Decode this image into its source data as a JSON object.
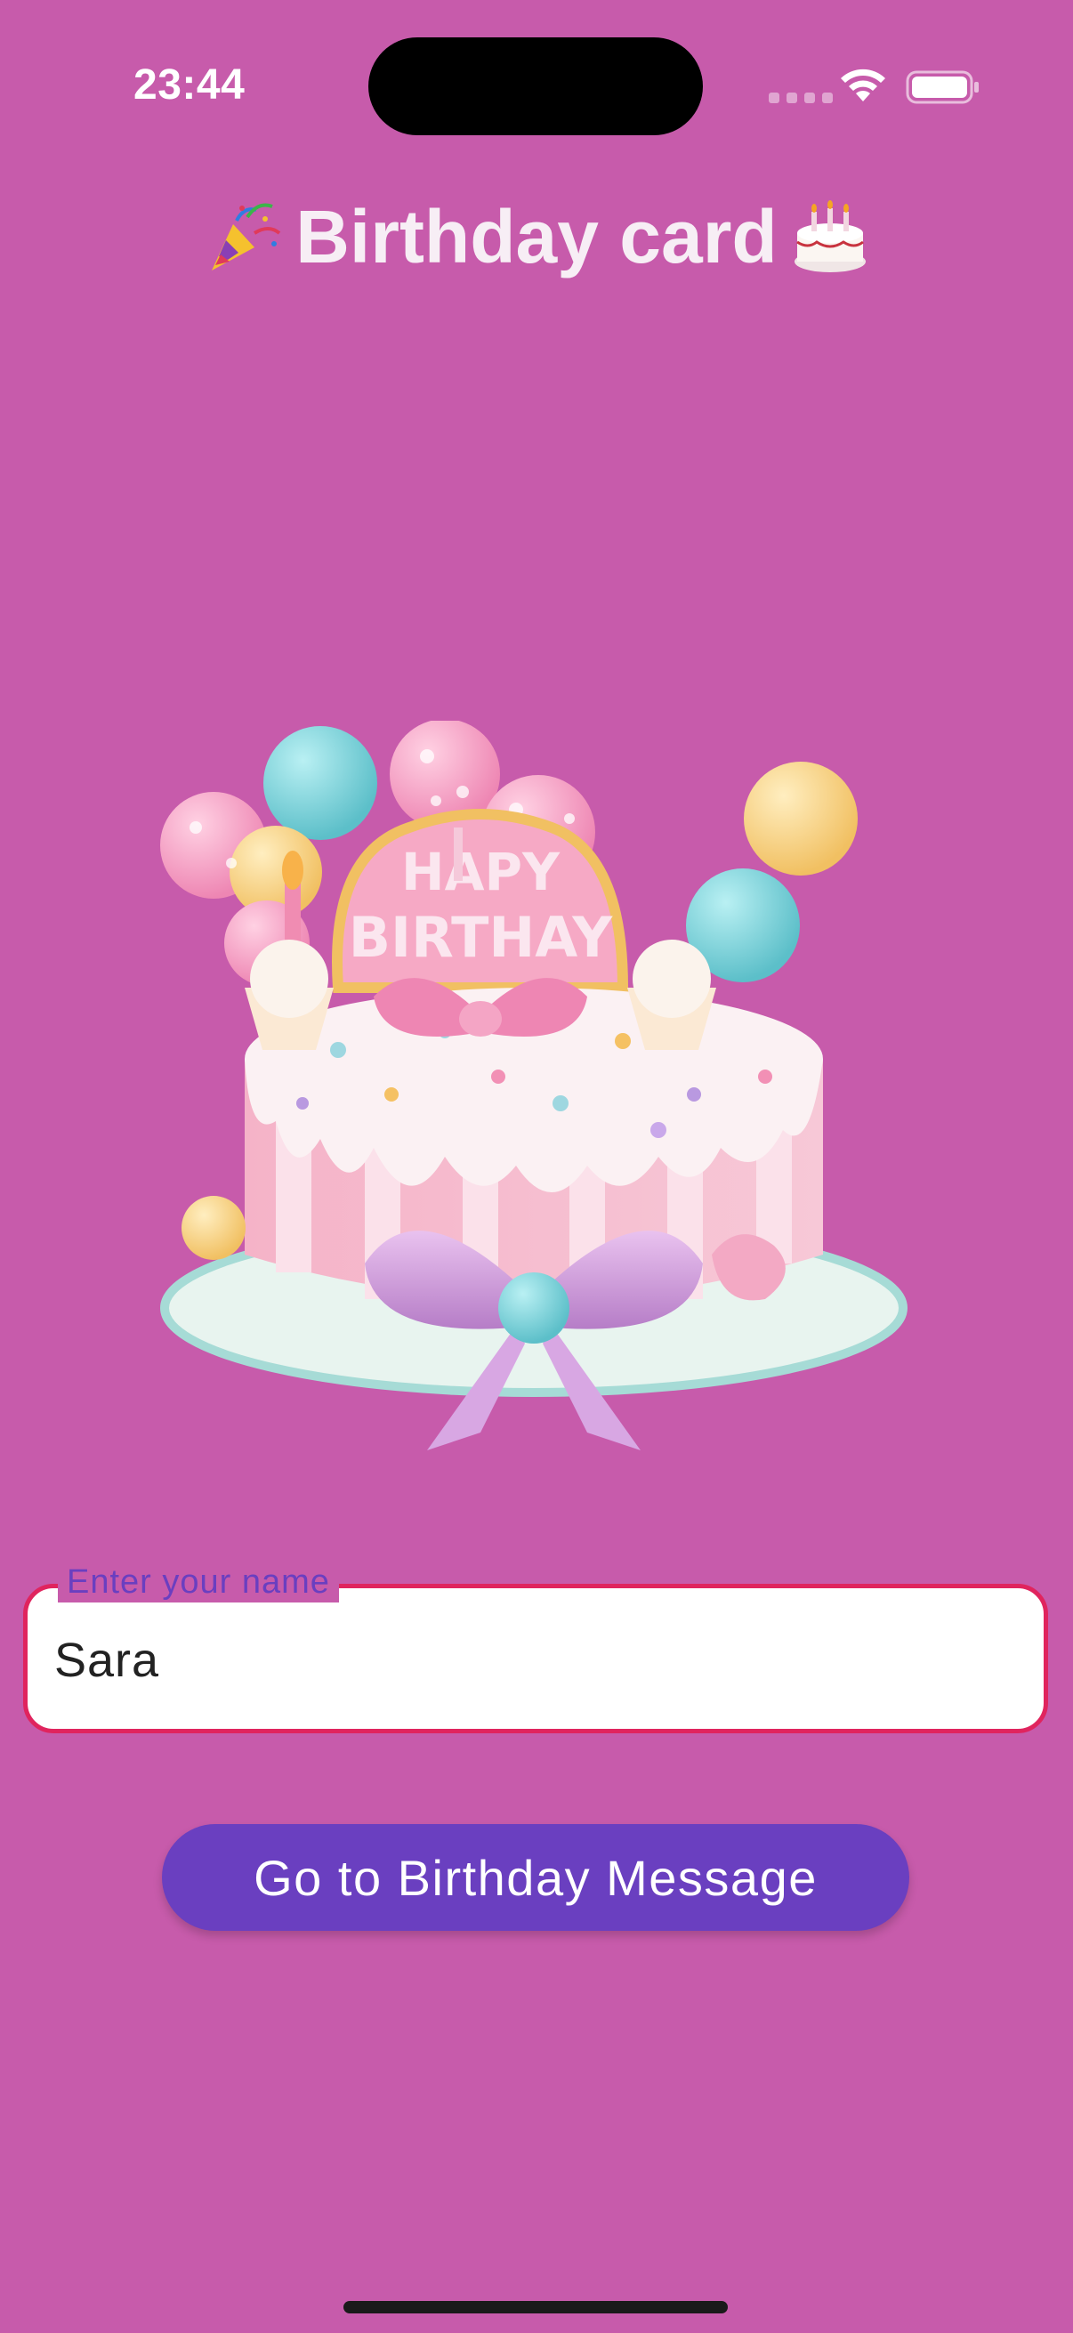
{
  "status_bar": {
    "time": "23:44"
  },
  "header": {
    "title": "Birthday card",
    "leading_icon": "party-popper-icon",
    "trailing_icon": "birthday-cake-icon"
  },
  "illustration": {
    "name": "birthday-cake-illustration",
    "plaque_text": "HAPY BIRTHAY"
  },
  "name_input": {
    "label": "Enter your name",
    "value": "Sara"
  },
  "actions": {
    "go_button_label": "Go to Birthday Message"
  },
  "colors": {
    "background": "#c75bab",
    "button": "#6a3fc0",
    "input_border": "#e0245e",
    "label": "#6a3fc0"
  }
}
